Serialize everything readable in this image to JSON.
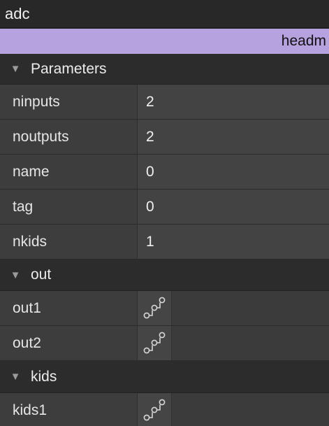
{
  "window": {
    "title": "adc"
  },
  "host": {
    "label": "headm"
  },
  "sections": {
    "parameters": {
      "label": "Parameters",
      "rows": [
        {
          "name": "ninputs",
          "value": "2"
        },
        {
          "name": "noutputs",
          "value": "2"
        },
        {
          "name": "name",
          "value": "0"
        },
        {
          "name": "tag",
          "value": "0"
        },
        {
          "name": "nkids",
          "value": "1"
        }
      ]
    },
    "out": {
      "label": "out",
      "rows": [
        {
          "name": "out1",
          "icon": "patch-cord-icon"
        },
        {
          "name": "out2",
          "icon": "patch-cord-icon"
        }
      ]
    },
    "kids": {
      "label": "kids",
      "rows": [
        {
          "name": "kids1",
          "icon": "patch-cord-icon"
        }
      ]
    }
  },
  "icons": {
    "collapse": "triangle-down-icon"
  },
  "colors": {
    "accent": "#b6a2de",
    "titlebar": "#282828",
    "section_header": "#2c2c2c"
  }
}
